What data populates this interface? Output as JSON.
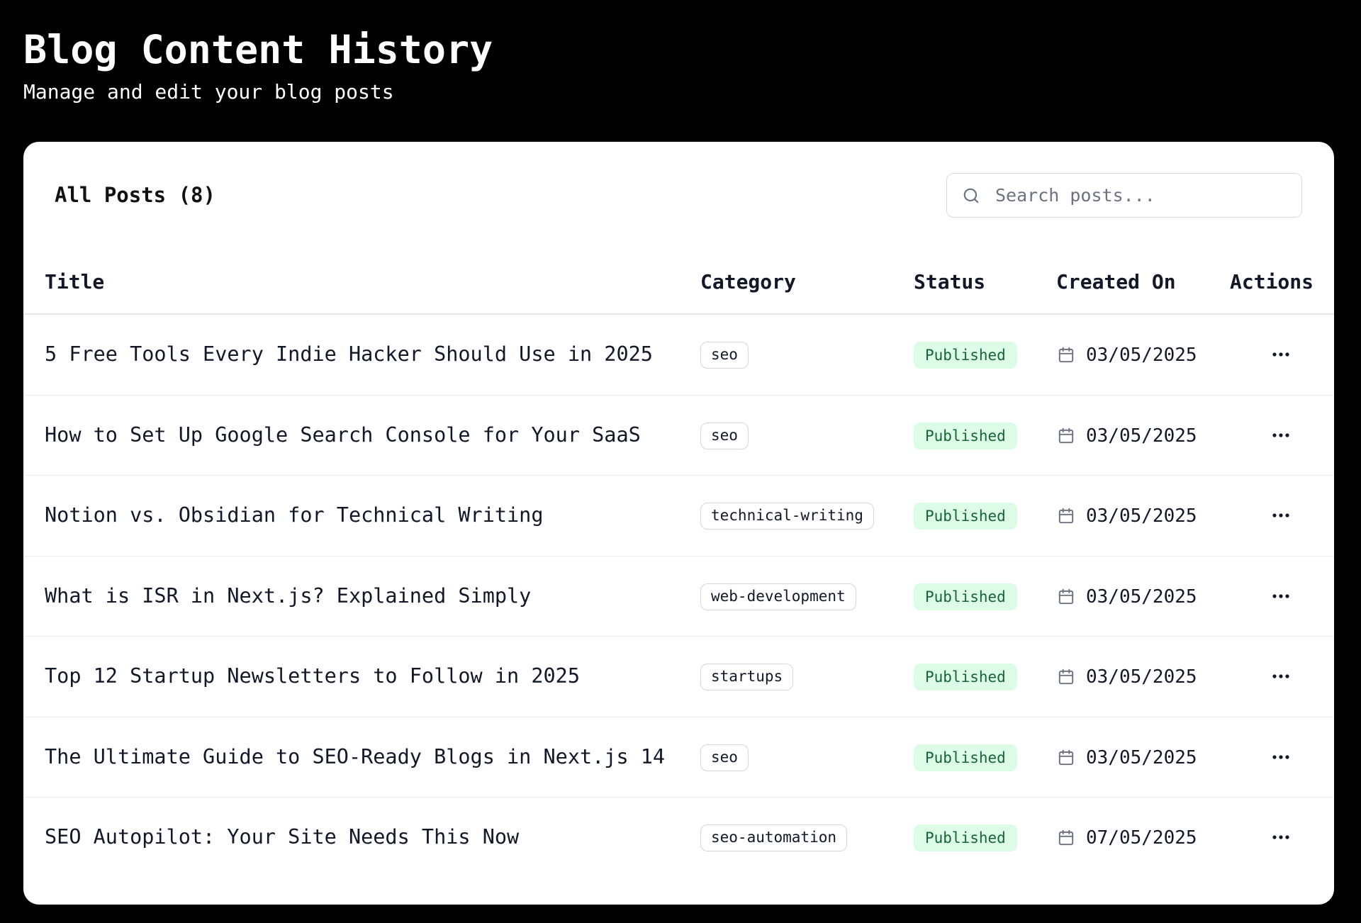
{
  "header": {
    "title": "Blog Content History",
    "subtitle": "Manage and edit your blog posts"
  },
  "card": {
    "title": "All Posts (8)",
    "search": {
      "placeholder": "Search posts...",
      "value": ""
    }
  },
  "table": {
    "columns": {
      "title": "Title",
      "category": "Category",
      "status": "Status",
      "created": "Created On",
      "actions": "Actions"
    },
    "rows": [
      {
        "title": "5 Free Tools Every Indie Hacker Should Use in 2025",
        "category": "seo",
        "status": "Published",
        "created": "03/05/2025"
      },
      {
        "title": "How to Set Up Google Search Console for Your SaaS",
        "category": "seo",
        "status": "Published",
        "created": "03/05/2025"
      },
      {
        "title": "Notion vs. Obsidian for Technical Writing",
        "category": "technical-writing",
        "status": "Published",
        "created": "03/05/2025"
      },
      {
        "title": "What is ISR in Next.js? Explained Simply",
        "category": "web-development",
        "status": "Published",
        "created": "03/05/2025"
      },
      {
        "title": "Top 12 Startup Newsletters to Follow in 2025",
        "category": "startups",
        "status": "Published",
        "created": "03/05/2025"
      },
      {
        "title": "The Ultimate Guide to SEO-Ready Blogs in Next.js 14",
        "category": "seo",
        "status": "Published",
        "created": "03/05/2025"
      },
      {
        "title": "SEO Autopilot: Your Site Needs This Now",
        "category": "seo-automation",
        "status": "Published",
        "created": "07/05/2025"
      }
    ]
  },
  "icons": {
    "search": "search-icon",
    "calendar": "calendar-icon",
    "more": "more-horizontal-icon"
  },
  "colors": {
    "background": "#000000",
    "card": "#ffffff",
    "status_published_bg": "#dcfce7",
    "status_published_text": "#166534"
  }
}
